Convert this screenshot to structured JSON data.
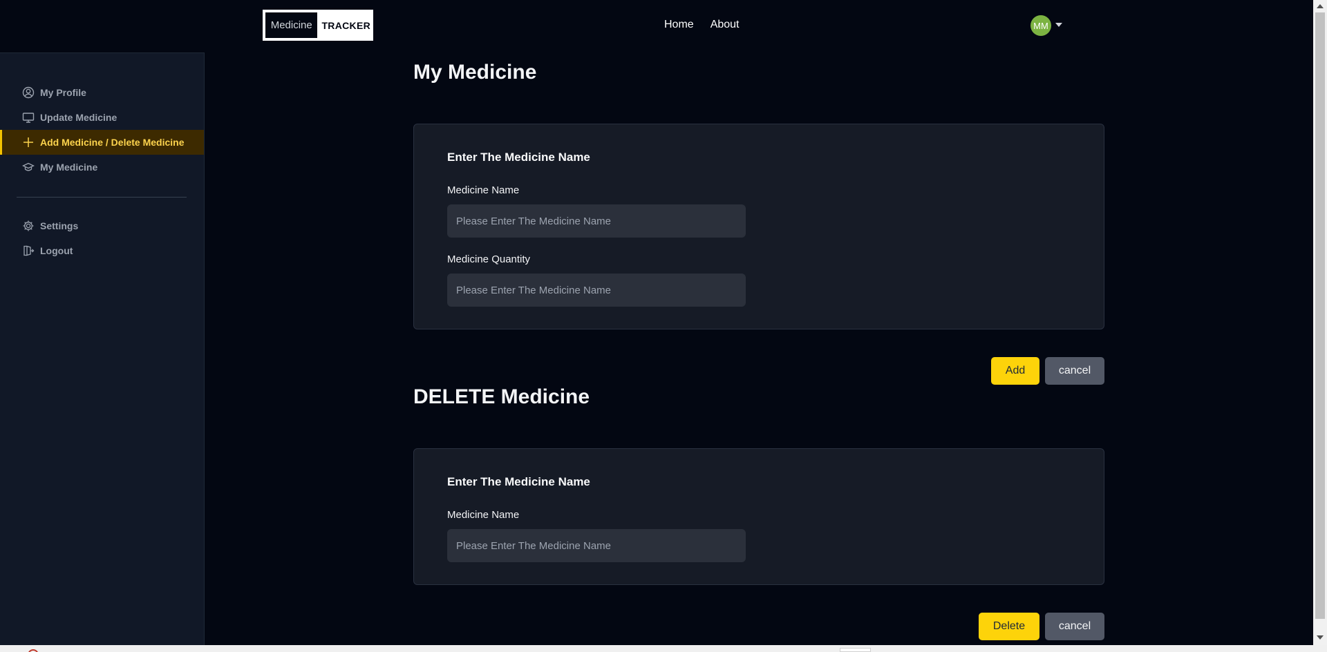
{
  "nav": {
    "logo_left": "Medicine",
    "logo_right": "TRACKER",
    "links": [
      "Home",
      "About"
    ],
    "avatar_initials": "MM"
  },
  "sidebar": {
    "items": [
      {
        "label": "My Profile",
        "icon": "user-circle-icon"
      },
      {
        "label": "Update Medicine",
        "icon": "monitor-icon"
      },
      {
        "label": "Add Medicine / Delete Medicine",
        "icon": "plus-icon",
        "active": true
      },
      {
        "label": "My Medicine",
        "icon": "graduation-cap-icon"
      },
      {
        "label": "Settings",
        "icon": "gear-icon"
      },
      {
        "label": "Logout",
        "icon": "logout-icon"
      }
    ]
  },
  "add_section": {
    "heading": "My Medicine",
    "card_title": "Enter The Medicine Name",
    "name_label": "Medicine Name",
    "name_placeholder": "Please Enter The Medicine Name",
    "quantity_label": "Medicine Quantity",
    "quantity_placeholder": "Please Enter The Medicine Name",
    "add_button": "Add",
    "cancel_button": "cancel"
  },
  "delete_section": {
    "heading": "DELETE Medicine",
    "card_title": "Enter The Medicine Name",
    "name_label": "Medicine Name",
    "name_placeholder": "Please Enter The Medicine Name",
    "delete_button": "Delete",
    "cancel_button": "cancel"
  },
  "colors": {
    "accent": "#fdd30a",
    "background": "#030712",
    "sidebar": "#111827",
    "card": "#161b26"
  }
}
